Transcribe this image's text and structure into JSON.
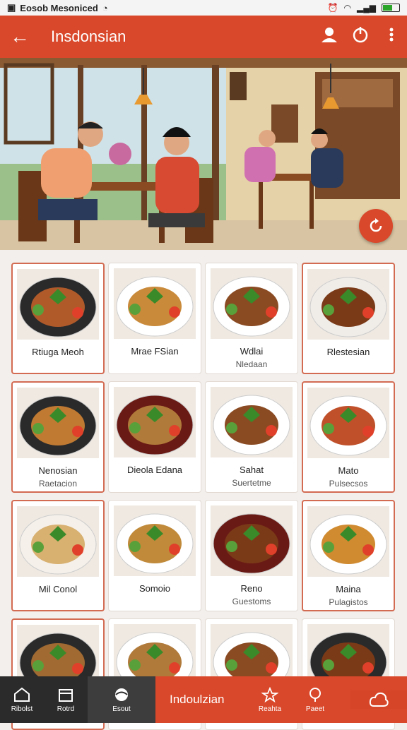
{
  "status": {
    "left_text": "Eosob Mesoniced",
    "time": "",
    "battery_level": 0.55
  },
  "header": {
    "title": "Insdonsian",
    "back_icon": "arrow-left-icon",
    "icons": [
      "user-icon",
      "power-icon",
      "more-vert-icon"
    ]
  },
  "hero": {
    "fab_icon": "refresh-icon",
    "accent": "#d9482a"
  },
  "dishes": [
    {
      "name": "Rtiuga Meoh",
      "sub": "",
      "plate": "#2a2a2a",
      "food": "#b05a2a"
    },
    {
      "name": "Mrae FSian",
      "sub": "",
      "plate": "#ffffff",
      "food": "#c98a3a"
    },
    {
      "name": "Wdlai",
      "sub": "Nledaan",
      "plate": "#ffffff",
      "food": "#8a4a22"
    },
    {
      "name": "Rlestesian",
      "sub": "",
      "plate": "#f0ece8",
      "food": "#7a3a18"
    },
    {
      "name": "Nenosian",
      "sub": "Raetacion",
      "plate": "#2a2a2a",
      "food": "#c07a32"
    },
    {
      "name": "Dieola Edana",
      "sub": "",
      "plate": "#6a1a14",
      "food": "#b07a3a"
    },
    {
      "name": "Sahat",
      "sub": "Suertetme",
      "plate": "#ffffff",
      "food": "#8a4a22"
    },
    {
      "name": "Mato",
      "sub": "Pulsecsos",
      "plate": "#ffffff",
      "food": "#c0502a"
    },
    {
      "name": "Mil Conol",
      "sub": "",
      "plate": "#f5f0ea",
      "food": "#d8b070"
    },
    {
      "name": "Somoio",
      "sub": "",
      "plate": "#ffffff",
      "food": "#c08a3a"
    },
    {
      "name": "Reno",
      "sub": "Guestoms",
      "plate": "#6a1a14",
      "food": "#7a3a18"
    },
    {
      "name": "Maina",
      "sub": "Pulagistos",
      "plate": "#ffffff",
      "food": "#d08a30"
    },
    {
      "name": "",
      "sub": "",
      "plate": "#2a2a2a",
      "food": "#a06a32"
    },
    {
      "name": "",
      "sub": "",
      "plate": "#ffffff",
      "food": "#b07a3a"
    },
    {
      "name": "",
      "sub": "",
      "plate": "#ffffff",
      "food": "#8a4a22"
    },
    {
      "name": "",
      "sub": "",
      "plate": "#2a2a2a",
      "food": "#7a3a18"
    }
  ],
  "nav": {
    "items": [
      {
        "label": "Ribolst",
        "icon": "home-icon"
      },
      {
        "label": "Rotrd",
        "icon": "calendar-icon"
      },
      {
        "label": "Esout",
        "icon": "globe-icon"
      }
    ],
    "feature_label": "Indoulzian",
    "feature_items": [
      {
        "label": "Reahta",
        "icon": "star-icon"
      },
      {
        "label": "Paeet",
        "icon": "pin-icon"
      }
    ],
    "last_icon": "cloud-icon"
  }
}
